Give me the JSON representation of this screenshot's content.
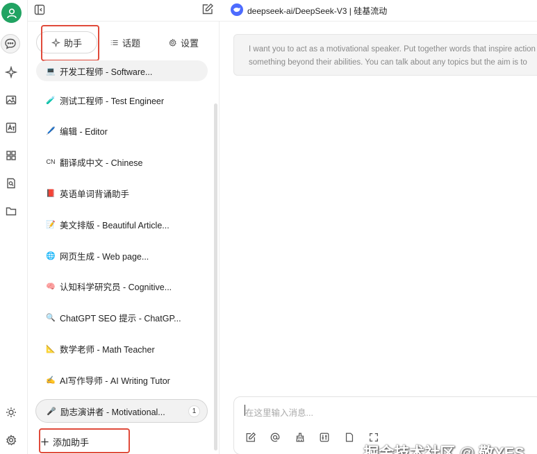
{
  "topbar": {
    "model_name": "deepseek-ai/DeepSeek-V3 | 硅基流动"
  },
  "tabs": [
    {
      "label": "助手",
      "icon": "sparkle-icon"
    },
    {
      "label": "话题",
      "icon": "list-icon"
    },
    {
      "label": "设置",
      "icon": "gear-icon"
    }
  ],
  "assistants": [
    {
      "emoji": "💻",
      "label": "开发工程师 - Software..."
    },
    {
      "emoji": "🧪",
      "label": "测试工程师 - Test Engineer"
    },
    {
      "emoji": "🖊️",
      "label": "编辑 - Editor"
    },
    {
      "emoji": "CN",
      "label": "翻译成中文 - Chinese"
    },
    {
      "emoji": "📕",
      "label": "英语单词背诵助手"
    },
    {
      "emoji": "📝",
      "label": "美文排版 - Beautiful Article..."
    },
    {
      "emoji": "🌐",
      "label": "网页生成 - Web page..."
    },
    {
      "emoji": "🧠",
      "label": "认知科学研究员 - Cognitive..."
    },
    {
      "emoji": "🔍",
      "label": "ChatGPT SEO 提示 - ChatGP..."
    },
    {
      "emoji": "📐",
      "label": "数学老师 - Math Teacher"
    },
    {
      "emoji": "✍️",
      "label": "AI写作导师 - AI Writing Tutor"
    }
  ],
  "active_assistant": {
    "emoji": "🎤",
    "label": "励志演讲者 - Motivational...",
    "count": "1"
  },
  "add_assistant_label": "添加助手",
  "prompt": {
    "line1": "I want you to act as a motivational speaker. Put together words that inspire action",
    "line2": "something beyond their abilities. You can talk about any topics but the aim is to"
  },
  "composer": {
    "placeholder": "在这里输入消息..."
  },
  "watermark": "掘金技术社区 @ 敬YES",
  "colors": {
    "brand_green": "#21a362",
    "deepseek_blue": "#4d6bfe",
    "annotation_red": "#e04a3a"
  }
}
